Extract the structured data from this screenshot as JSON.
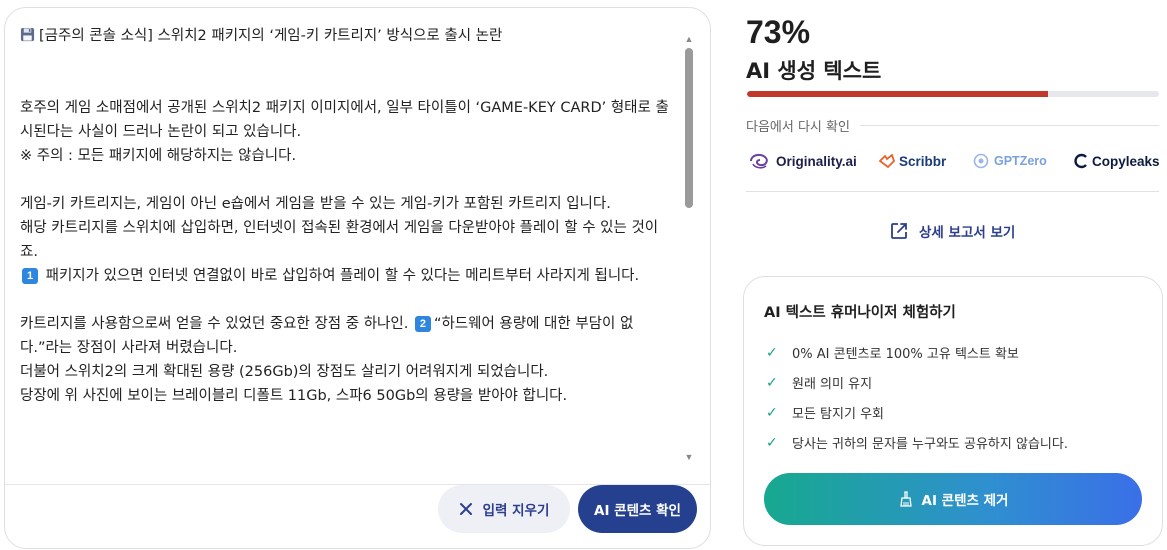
{
  "editor": {
    "title": "[금주의 콘솔 소식] 스위치2 패키지의 ‘게임-키 카트리지’ 방식으로 출시 논란",
    "para1": [
      "호주의 게임 소매점에서 공개된 스위치2 패키지 이미지에서, 일부 타이틀이 ‘GAME-KEY CARD’ 형태로 출시된다는 사실이 드러나 논란이 되고 있습니다.",
      "※ 주의 : 모든 패키지에 해당하지는 않습니다."
    ],
    "para2": [
      "게임-키 카트리지는, 게임이 아닌 e숍에서 게임을 받을 수 있는 게임-키가 포함된 카트리지 입니다.",
      "해당 카트리지를 스위치에 삽입하면, 인터넷이 접속된 환경에서 게임을 다운받아야 플레이 할 수 있는 것이죠."
    ],
    "badge1": "1",
    "para2_badge_text": "패키지가 있으면 인터넷 연결없이 바로 삽입하여 플레이 할 수 있다는 메리트부터 사라지게 됩니다.",
    "para3_pre": "카트리지를 사용함으로써 얻을 수 있었던 중요한 장점 중 하나인.",
    "badge2": "2",
    "para3_post": "“하드웨어 용량에 대한 부담이 없다.”라는 장점이 사라져 버렸습니다.",
    "para3_lines": [
      "더불어 스위치2의 크게 확대된 용량 (256Gb)의 장점도 살리기 어려워지게 되었습니다.",
      "당장에 위 사진에 보이는 브레이블리 디폴트 11Gb, 스파6 50Gb의 용량을 받아야 합니다."
    ],
    "clear_label": "입력 지우기",
    "check_label": "AI 콘텐츠 확인"
  },
  "result": {
    "percent": "73%",
    "label": "AI 생성 텍스트",
    "progress_fraction": 0.73,
    "bar_color": "#c0392b",
    "recheck_label": "다음에서 다시 확인",
    "tools": [
      {
        "name": "Originality.ai",
        "icon": "originality-icon"
      },
      {
        "name": "Scribbr",
        "icon": "scribbr-icon"
      },
      {
        "name": "GPTZero",
        "icon": "gptzero-icon"
      },
      {
        "name": "Copyleaks",
        "icon": "copyleaks-icon"
      }
    ],
    "report_link": "상세 보고서 보기"
  },
  "humanizer": {
    "title": "AI 텍스트 휴머나이저 체험하기",
    "features": [
      "0% AI 콘텐츠로 100% 고유 텍스트 확보",
      "원래 의미 유지",
      "모든 탐지기 우회",
      "당사는 귀하의 문자를 누구와도 공유하지 않습니다."
    ],
    "button_label": "AI 콘텐츠 제거"
  }
}
